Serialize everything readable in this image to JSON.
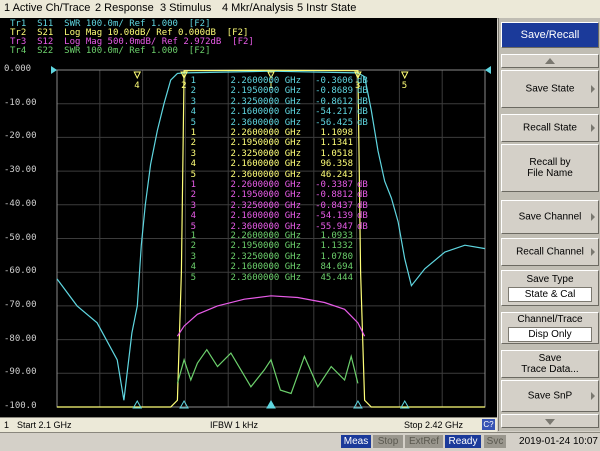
{
  "menu": [
    "1 Active Ch/Trace",
    "2 Response",
    "3 Stimulus",
    "4 Mkr/Analysis",
    "5 Instr State"
  ],
  "traces": [
    {
      "label": "Tr1  S11  SWR 100.0m/ Ref 1.000  [F2]",
      "color": "#5fd6e0"
    },
    {
      "label": "Tr2  S21  Log Mag 10.00dB/ Ref 0.000dB  [F2]",
      "color": "#ffff78"
    },
    {
      "label": "Tr3  S12  Log Mag 500.0mdB/ Ref 2.972dB  [F2]",
      "color": "#e85ce8"
    },
    {
      "label": "Tr4  S22  SWR 100.0m/ Ref 1.000  [F2]",
      "color": "#6cd06c"
    }
  ],
  "active_trace_box": "Tr2",
  "y_labels": [
    "0.000",
    "-10.00",
    "-20.00",
    "-30.00",
    "-40.00",
    "-50.00",
    "-60.00",
    "-70.00",
    "-80.00",
    "-90.00",
    "-100.0"
  ],
  "marker_tables": [
    {
      "color": "#5fd6e0",
      "rows": [
        [
          "1",
          "2.2600000 GHz",
          "-0.3606",
          "dB"
        ],
        [
          "2",
          "2.1950000 GHz",
          "-0.8689",
          "dB"
        ],
        [
          "3",
          "2.3250000 GHz",
          "-0.8612",
          "dB"
        ],
        [
          "4",
          "2.1600000 GHz",
          "-54.217",
          "dB"
        ],
        [
          "5",
          "2.3600000 GHz",
          "-56.425",
          "dB"
        ]
      ]
    },
    {
      "color": "#ffff78",
      "rows": [
        [
          "1",
          "2.2600000 GHz",
          "1.1098",
          ""
        ],
        [
          "2",
          "2.1950000 GHz",
          "1.1341",
          ""
        ],
        [
          "3",
          "2.3250000 GHz",
          "1.0518",
          ""
        ],
        [
          "4",
          "2.1600000 GHz",
          "96.358",
          ""
        ],
        [
          "5",
          "2.3600000 GHz",
          "46.243",
          ""
        ]
      ]
    },
    {
      "color": "#e85ce8",
      "rows": [
        [
          "1",
          "2.2600000 GHz",
          "-0.3387",
          "dB"
        ],
        [
          "2",
          "2.1950000 GHz",
          "-0.8812",
          "dB"
        ],
        [
          "3",
          "2.3250000 GHz",
          "-0.8437",
          "dB"
        ],
        [
          "4",
          "2.1600000 GHz",
          "-54.139",
          "dB"
        ],
        [
          "5",
          "2.3600000 GHz",
          "-55.947",
          "dB"
        ]
      ]
    },
    {
      "color": "#6cd06c",
      "rows": [
        [
          "1",
          "2.2600000 GHz",
          "1.0933",
          ""
        ],
        [
          "2",
          "2.1950000 GHz",
          "1.1332",
          ""
        ],
        [
          "3",
          "2.3250000 GHz",
          "1.0780",
          ""
        ],
        [
          "4",
          "2.1600000 GHz",
          "84.694",
          ""
        ],
        [
          "5",
          "2.3600000 GHz",
          "45.444",
          ""
        ]
      ]
    }
  ],
  "status": {
    "channel": "1",
    "start": "Start 2.1 GHz",
    "ifbw": "IFBW 1 kHz",
    "stop": "Stop 2.42 GHz",
    "channel_tag": "C?"
  },
  "indicators": [
    "Meas",
    "Stop",
    "ExtRef",
    "Ready",
    "Svc"
  ],
  "datetime": "2019-01-24 10:07",
  "softkeys": [
    {
      "label": "Save/Recall",
      "kind": "title"
    },
    {
      "label": "Save State",
      "arrow": true
    },
    {
      "label": "Recall State",
      "arrow": true
    },
    {
      "label": "Recall by",
      "line2": "File Name",
      "arrow": false
    },
    {
      "label": "Save Channel",
      "arrow": true
    },
    {
      "label": "Recall Channel",
      "arrow": true
    },
    {
      "label": "Save Type",
      "value": "State & Cal"
    },
    {
      "label": "Channel/Trace",
      "value": "Disp Only"
    },
    {
      "label": "Save",
      "line2": "Trace Data...",
      "arrow": false
    },
    {
      "label": "Save SnP",
      "arrow": true
    }
  ],
  "chart_data": {
    "type": "line",
    "title": "",
    "x_range_ghz": [
      2.1,
      2.42
    ],
    "y_range_db": [
      -100,
      0
    ],
    "grid": true,
    "series": [
      {
        "name": "Tr1 S11 SWR",
        "color": "#5fd6e0",
        "x": [
          2.1,
          2.115,
          2.13,
          2.145,
          2.15,
          2.156,
          2.16,
          2.163,
          2.166,
          2.17,
          2.175,
          2.18,
          2.185,
          2.19,
          2.195,
          2.26,
          2.325,
          2.33,
          2.335,
          2.34,
          2.345,
          2.35,
          2.355,
          2.36,
          2.365,
          2.375,
          2.39,
          2.405,
          2.42
        ],
        "y": [
          -62,
          -70,
          -75,
          -86,
          -98,
          -78,
          -70,
          -52,
          -40,
          -28,
          -18,
          -10,
          -3,
          -1,
          -0.87,
          -0.36,
          -0.86,
          -2,
          -12,
          -24,
          -33,
          -38,
          -45,
          -56,
          -64,
          -59,
          -54,
          -52,
          -53
        ]
      },
      {
        "name": "Tr2 S21 Log Mag",
        "color": "#ffff78",
        "x": [
          2.1,
          2.185,
          2.19,
          2.193,
          2.195,
          2.26,
          2.325,
          2.327,
          2.33,
          2.335,
          2.42
        ],
        "y": [
          -100,
          -100,
          -98,
          -60,
          -0.2,
          -0.1,
          -0.2,
          -60,
          -98,
          -100,
          -100
        ]
      },
      {
        "name": "Tr3 S12 Log Mag",
        "color": "#e85ce8",
        "x": [
          2.19,
          2.195,
          2.205,
          2.22,
          2.24,
          2.26,
          2.28,
          2.3,
          2.315,
          2.325,
          2.33
        ],
        "y": [
          -79,
          -76,
          -72.5,
          -70,
          -68,
          -67,
          -67.5,
          -69,
          -71,
          -75,
          -79
        ]
      },
      {
        "name": "Tr4 S22 SWR",
        "color": "#6cd06c",
        "x": [
          2.19,
          2.195,
          2.2,
          2.205,
          2.212,
          2.22,
          2.23,
          2.245,
          2.255,
          2.26,
          2.267,
          2.275,
          2.285,
          2.295,
          2.305,
          2.315,
          2.32,
          2.325
        ],
        "y": [
          -93,
          -86,
          -92,
          -87,
          -83,
          -88,
          -84,
          -94,
          -89,
          -86,
          -95,
          -96,
          -85,
          -94,
          -88,
          -92,
          -85,
          -93
        ]
      }
    ],
    "markers_ghz": [
      2.26,
      2.195,
      2.325,
      2.16,
      2.36
    ]
  }
}
